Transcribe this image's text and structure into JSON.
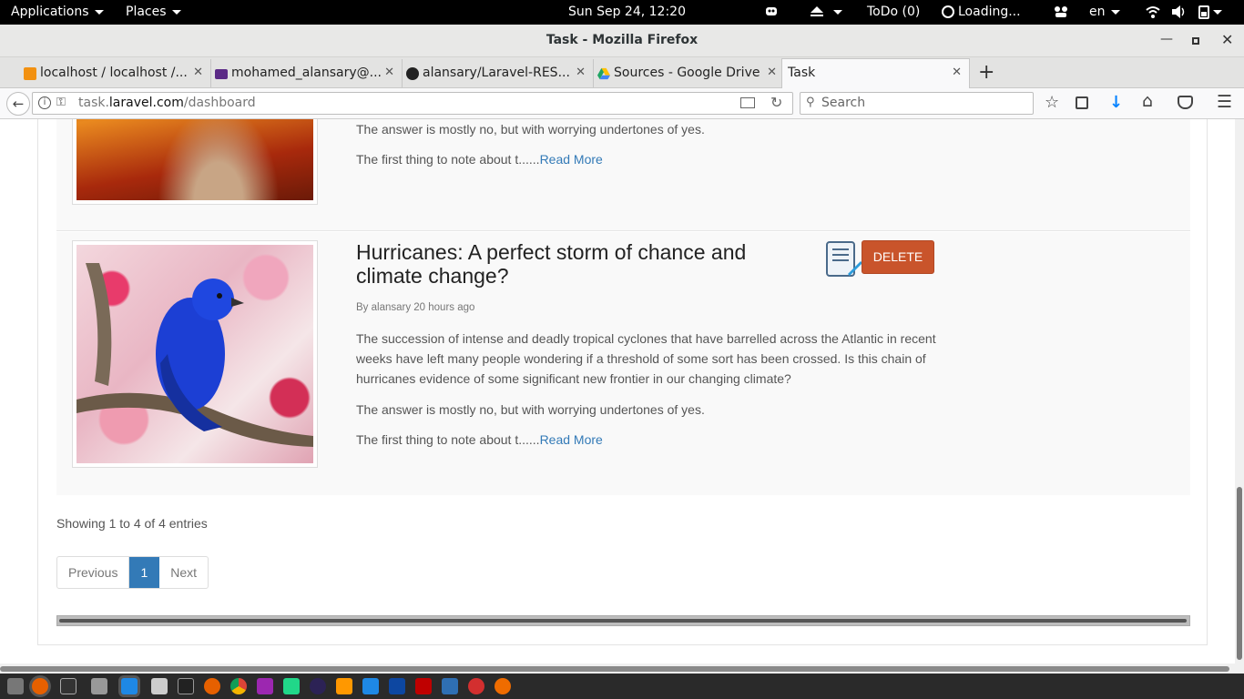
{
  "topbar": {
    "applications": "Applications",
    "places": "Places",
    "clock": "Sun Sep 24, 12:20",
    "todo": "ToDo (0)",
    "loading": "Loading...",
    "lang": "en"
  },
  "window": {
    "title": "Task - Mozilla Firefox"
  },
  "tabs": [
    {
      "label": "localhost / localhost /...",
      "color": "#f29111"
    },
    {
      "label": "mohamed_alansary@...",
      "color": "#5b2a86"
    },
    {
      "label": "alansary/Laravel-RES...",
      "color": "#222222"
    },
    {
      "label": "Sources - Google Drive",
      "color": "#1fa463"
    },
    {
      "label": "Task",
      "color": ""
    }
  ],
  "nav": {
    "url_host_pre": "task.",
    "url_host": "laravel.com",
    "url_path": "/dashboard",
    "search_placeholder": "Search"
  },
  "posts": [
    {
      "answer": "The answer is mostly no, but with worrying undertones of yes.",
      "teaser": "The first thing to note about t......",
      "read_more": "Read More"
    },
    {
      "title": "Hurricanes: A perfect storm of chance and climate change?",
      "byline": "By alansary 20 hours ago",
      "body": "The succession of intense and deadly tropical cyclones that have barrelled across the Atlantic in recent weeks have left many people wondering if a threshold of some sort has been crossed. Is this chain of hurricanes evidence of some significant new frontier in our changing climate?",
      "answer": "The answer is mostly no, but with worrying undertones of yes.",
      "teaser": "The first thing to note about t......",
      "read_more": "Read More",
      "delete_label": "DELETE"
    }
  ],
  "table_info": "Showing 1 to 4 of 4 entries",
  "pagination": {
    "previous": "Previous",
    "current": "1",
    "next": "Next"
  },
  "colors": {
    "delete": "#c9542b",
    "link": "#337ab7",
    "page_active": "#337ab7"
  }
}
